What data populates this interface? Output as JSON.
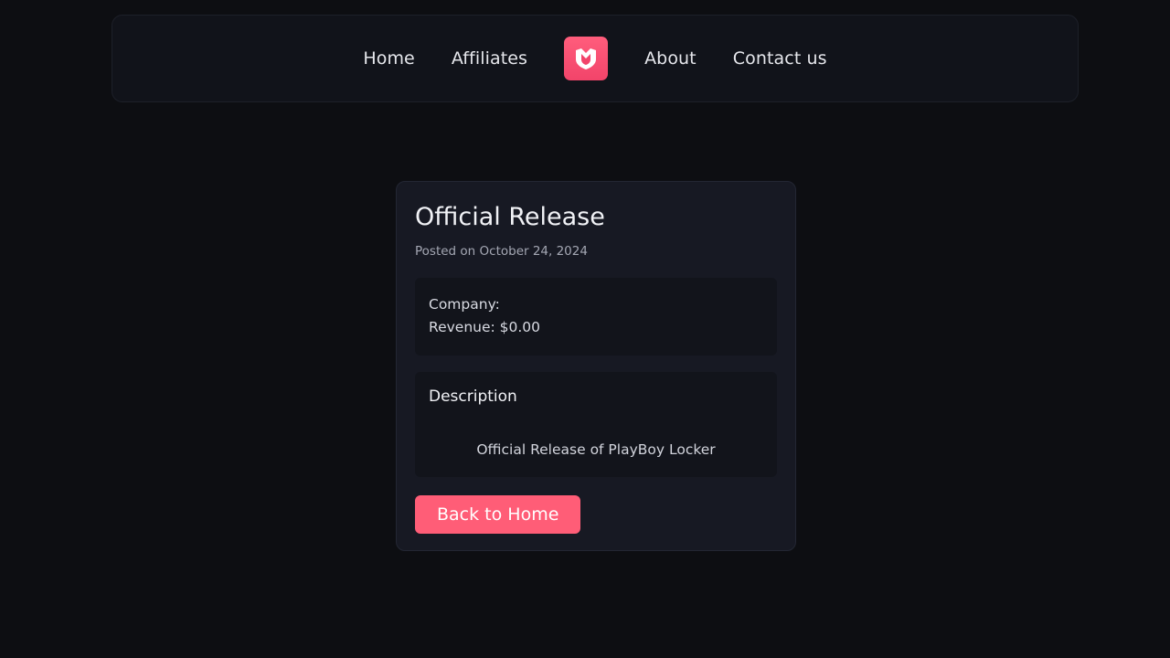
{
  "nav": {
    "links_left": [
      "Home",
      "Affiliates"
    ],
    "links_right": [
      "About",
      "Contact us"
    ],
    "logo_icon": "shield-logo-icon"
  },
  "post": {
    "title": "Official Release",
    "date": "Posted on October 24, 2024",
    "company": "Company:",
    "revenue": "Revenue: $0.00",
    "description_heading": "Description",
    "description_text": "Official Release of PlayBoy Locker",
    "back_button": "Back to Home"
  },
  "colors": {
    "background": "#0d0e12",
    "nav_background": "#11131a",
    "card_background": "#171923",
    "accent": "#ff5d77"
  }
}
